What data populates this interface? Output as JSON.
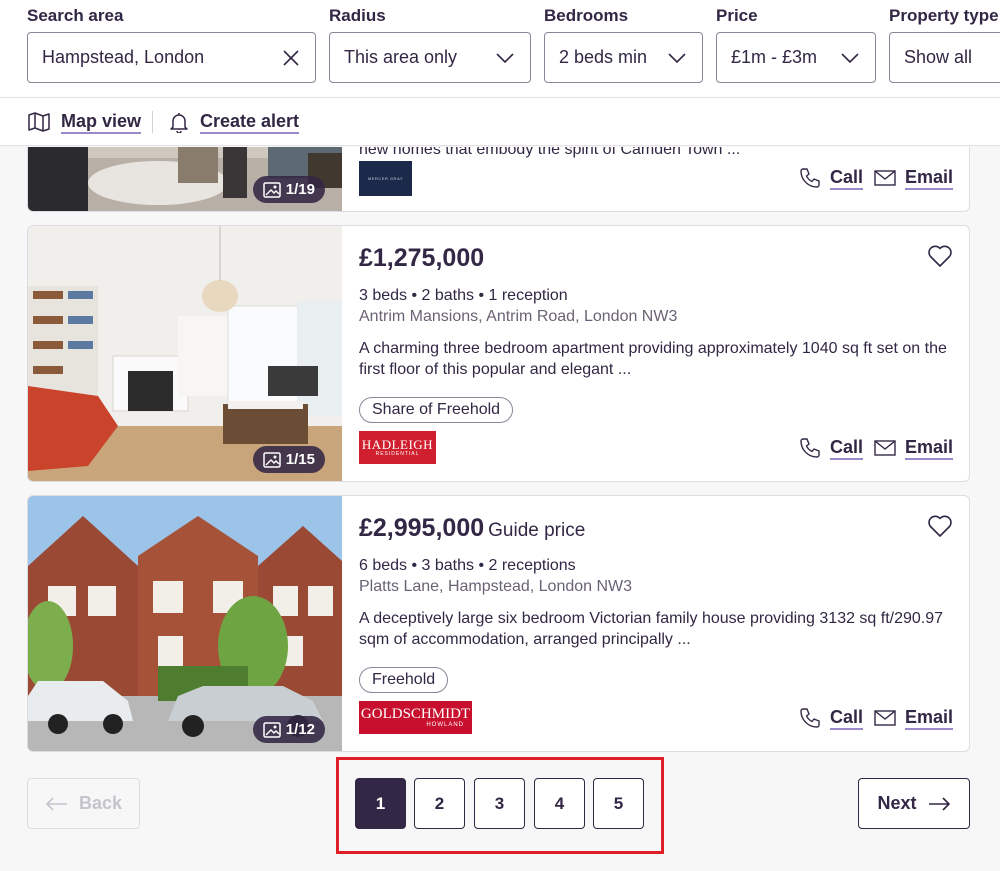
{
  "filters": {
    "search_area": {
      "label": "Search area",
      "value": "Hampstead, London"
    },
    "radius": {
      "label": "Radius",
      "value": "This area only"
    },
    "bedrooms": {
      "label": "Bedrooms",
      "value": "2 beds min"
    },
    "price": {
      "label": "Price",
      "value": "£1m - £3m"
    },
    "property_type": {
      "label": "Property type",
      "value": "Show all"
    }
  },
  "toolbar": {
    "map_view": "Map view",
    "create_alert": "Create alert"
  },
  "listings": [
    {
      "desc_partial": "new homes that embody the spirit of Camden Town ...",
      "photo_count": "1/19",
      "agent": "MERCER GRAY",
      "call": "Call",
      "email": "Email"
    },
    {
      "price": "£1,275,000",
      "price_qualifier": "",
      "specs": "3 beds • 2 baths • 1 reception",
      "address": "Antrim Mansions, Antrim Road, London NW3",
      "description": "A charming three bedroom apartment providing approximately 1040 sq ft set on the first floor of this popular and elegant ...",
      "tenure": "Share of Freehold",
      "photo_count": "1/15",
      "agent": "HADLEIGH",
      "agent_sub": "RESIDENTIAL",
      "call": "Call",
      "email": "Email"
    },
    {
      "price": "£2,995,000",
      "price_qualifier": "Guide price",
      "specs": "6 beds • 3 baths • 2 receptions",
      "address": "Platts Lane, Hampstead, London NW3",
      "description": "A deceptively large six bedroom Victorian family house providing 3132 sq ft/290.97 sqm of accommodation, arranged principally ...",
      "tenure": "Freehold",
      "photo_count": "1/12",
      "agent": "GOLDSCHMIDT",
      "agent_sub": "HOWLAND",
      "call": "Call",
      "email": "Email"
    }
  ],
  "pagination": {
    "back": "Back",
    "next": "Next",
    "pages": [
      "1",
      "2",
      "3",
      "4",
      "5"
    ],
    "current": "1"
  },
  "colors": {
    "brand": "#322744",
    "accent_underline": "#9a8ac8",
    "highlight": "#e11e26"
  }
}
